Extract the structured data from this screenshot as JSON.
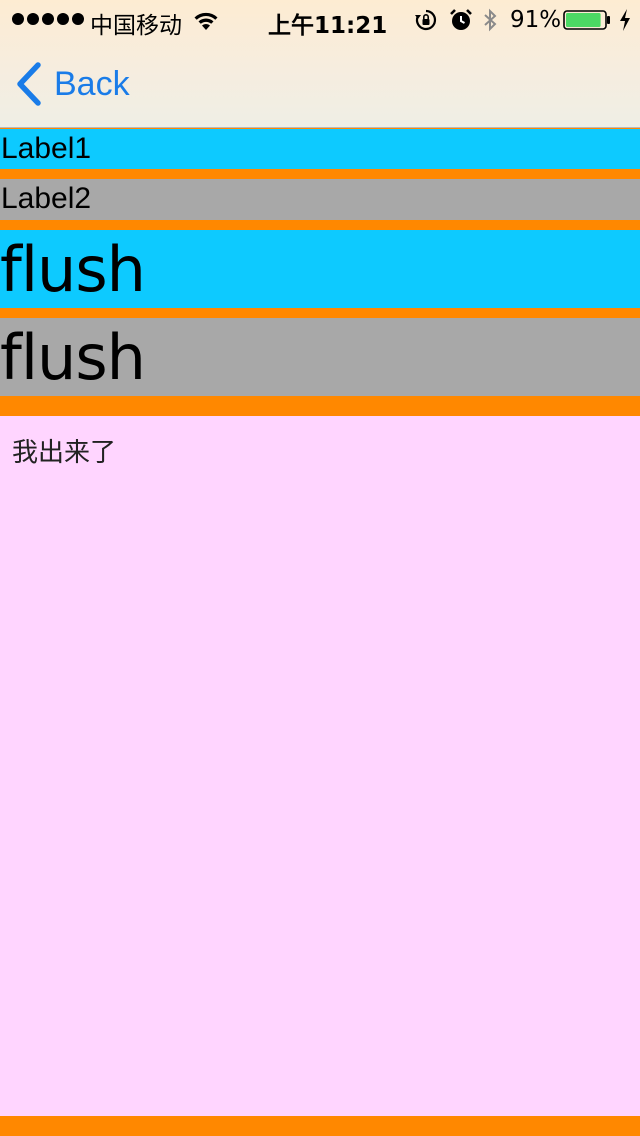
{
  "status_bar": {
    "signal_dots": 5,
    "carrier": "中国移动",
    "wifi_icon": "wifi-icon",
    "time": "上午11:21",
    "orientation_lock_icon": "orientation-lock-icon",
    "alarm_icon": "alarm-icon",
    "bluetooth_icon": "bluetooth-icon",
    "battery_percent": "91%",
    "battery_level": 0.91,
    "battery_color": "#4cd964",
    "charging_icon": "charging-bolt-icon"
  },
  "nav": {
    "back_icon": "chevron-left-icon",
    "back_label": "Back",
    "tint_color": "#1a7ce8"
  },
  "rows": [
    {
      "text": "Label1",
      "color": "#0dcaff"
    },
    {
      "text": "Label2",
      "color": "#a8a8a8"
    },
    {
      "text": "flush",
      "color": "#0dcaff"
    },
    {
      "text": "flush",
      "color": "#a8a8a8"
    }
  ],
  "separator_color": "#ff8800",
  "content": {
    "text": "我出来了",
    "background": "#ffd5ff"
  }
}
